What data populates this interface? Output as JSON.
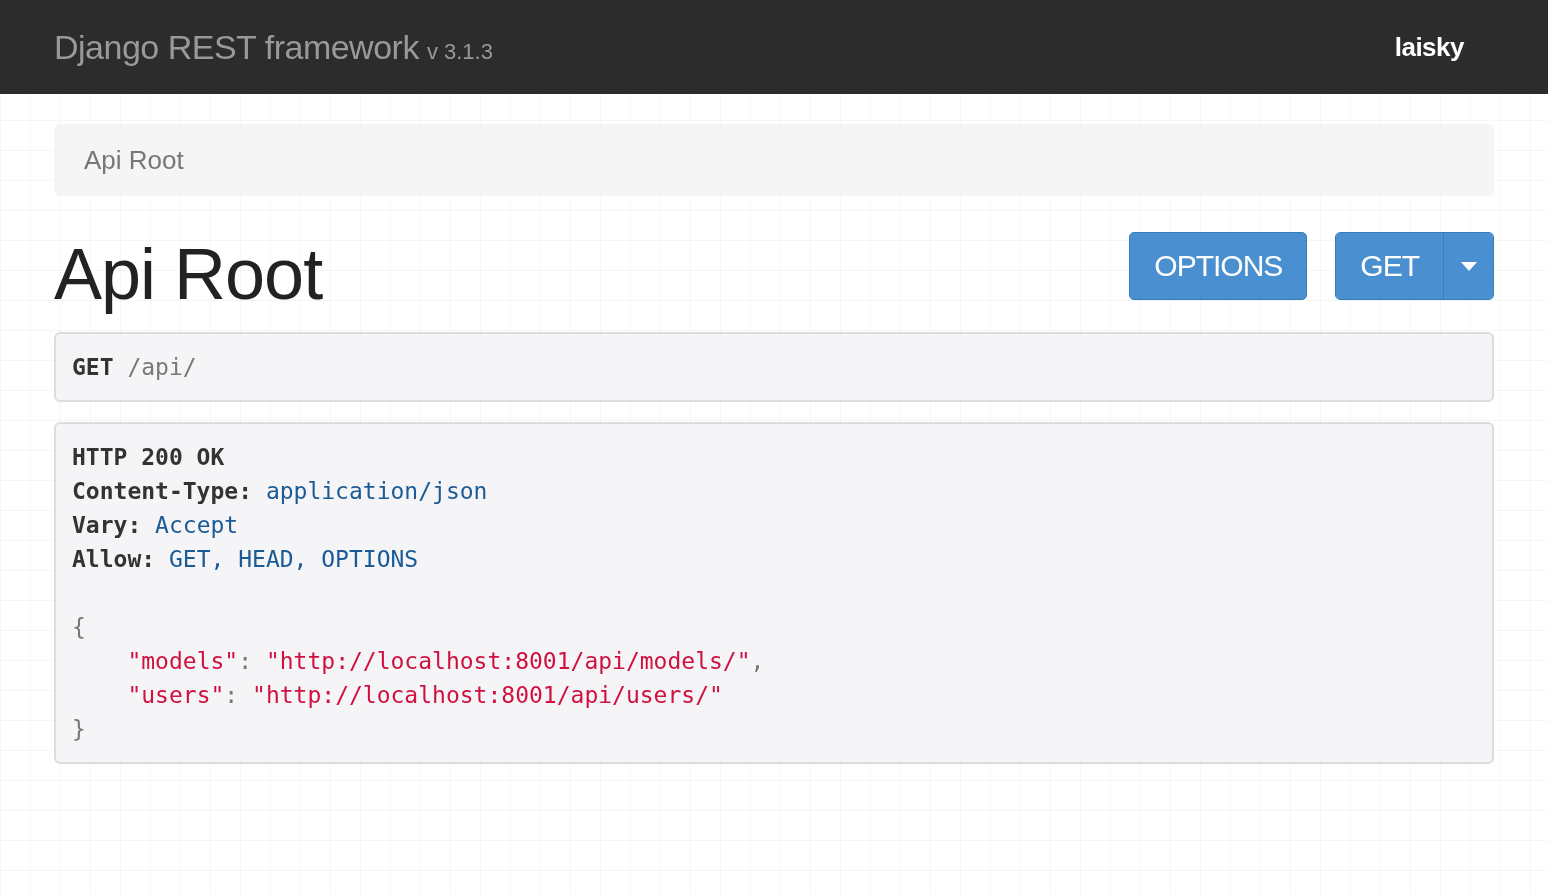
{
  "navbar": {
    "brand": "Django REST framework",
    "version": "v 3.1.3",
    "user": "laisky"
  },
  "breadcrumb": {
    "items": [
      {
        "label": "Api Root",
        "selected": true
      }
    ]
  },
  "page_title": "Api Root",
  "buttons": {
    "options": "OPTIONS",
    "get": "GET"
  },
  "request": {
    "method": "GET",
    "path": "/api/"
  },
  "response": {
    "status": "HTTP 200 OK",
    "headers": [
      {
        "name": "Content-Type:",
        "value": "application/json"
      },
      {
        "name": "Vary:",
        "value": "Accept"
      },
      {
        "name": "Allow:",
        "value": "GET, HEAD, OPTIONS"
      }
    ],
    "open_brace": "{",
    "entries": [
      {
        "key": "\"models\"",
        "colon": ":",
        "value": "\"http://localhost:8001/api/models/\"",
        "comma": ","
      },
      {
        "key": "\"users\"",
        "colon": ":",
        "value": "\"http://localhost:8001/api/users/\""
      }
    ],
    "close_brace": "}"
  }
}
